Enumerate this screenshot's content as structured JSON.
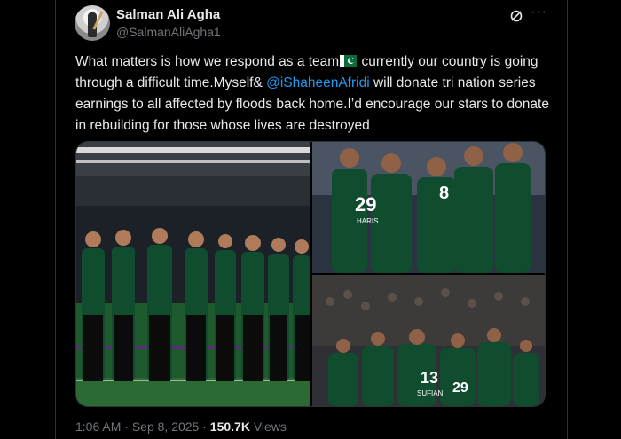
{
  "author": {
    "display_name": "Salman Ali Agha",
    "handle": "@SalmanAliAgha1"
  },
  "tweet": {
    "text_part1": "What matters is how we respond as a team",
    "text_part2": " currently our country is going through a difficult time.Myself& ",
    "mention": "@iShaheenAfridi",
    "text_part3": " will donate tri nation series earnings to all affected by floods back home.I’d encourage our stars to donate in rebuilding for those whose lives are destroyed"
  },
  "jersey_numbers": {
    "p2_a": "29",
    "p2_a_name": "HARIS",
    "p2_b": "8",
    "p3_a": "13",
    "p3_a_name": "SUFIAN",
    "p3_b": "29"
  },
  "meta": {
    "time": "1:06 AM",
    "sep": " · ",
    "date": "Sep 8, 2025",
    "sep2": " · ",
    "views_count": "150.7K",
    "views_label": " Views"
  },
  "icons": [
    "grok-icon",
    "more-icon",
    "flag-emoji"
  ],
  "colors": {
    "background": "#000000",
    "text": "#e7e9ea",
    "muted": "#71767b",
    "link": "#1d9bf0",
    "jersey": "#0f4d2e"
  }
}
